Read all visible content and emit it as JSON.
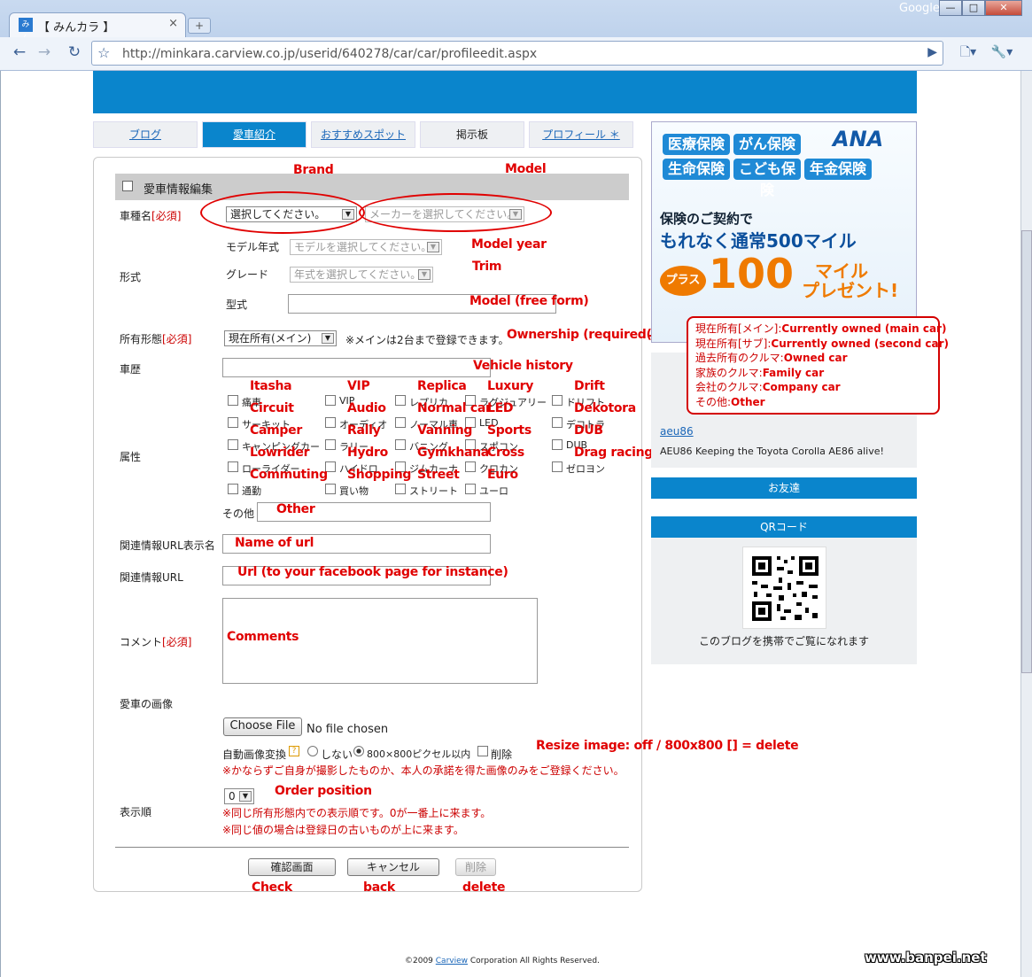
{
  "browser": {
    "tab_title": "【 みんカラ 】",
    "tab_close": "×",
    "new_tab": "+",
    "brand_label": "Google",
    "url": "http://minkara.carview.co.jp/userid/640278/car/car/profileedit.aspx",
    "window_buttons": [
      "—",
      "□",
      "✕"
    ]
  },
  "nav_tabs": [
    {
      "label": "ブログ"
    },
    {
      "label": "愛車紹介"
    },
    {
      "label": "おすすめスポット"
    },
    {
      "label": "掲示板"
    },
    {
      "label": "プロフィール ＊"
    }
  ],
  "form": {
    "header": "愛車情報編集",
    "car_name_label": "車種名",
    "required_tag": "[必須]",
    "brand_select": "選択してください。",
    "model_select": "メーカーを選択してください。",
    "model_year_label": "モデル年式",
    "model_year_select": "モデルを選択してください。",
    "grade_label": "グレード",
    "grade_select": "年式を選択してください。",
    "type_label": "形式",
    "katashiki_label": "型式",
    "ownership_label": "所有形態",
    "ownership_select": "現在所有(メイン)",
    "ownership_note": "※メインは2台まで登録できます。",
    "history_label": "車歴",
    "attributes_label": "属性",
    "attributes": [
      [
        "痛車",
        "VIP",
        "レプリカ",
        "ラグジュアリー",
        "ドリフト"
      ],
      [
        "サーキット",
        "オーディオ",
        "ノーマル車",
        "LED",
        "デコトラ"
      ],
      [
        "キャンピングカー",
        "ラリー",
        "バニング",
        "スポコン",
        "DUB"
      ],
      [
        "ローライダー",
        "ハイドロ",
        "ジムカーナ",
        "クロカン",
        "ゼロヨン"
      ],
      [
        "通勤",
        "買い物",
        "ストリート",
        "ユーロ"
      ]
    ],
    "other_label": "その他",
    "url_name_label": "関連情報URL表示名",
    "url_label": "関連情報URL",
    "comment_label": "コメント",
    "image_label": "愛車の画像",
    "choose_file": "Choose File",
    "no_file": "No file chosen",
    "auto_convert_label": "自動画像変換",
    "help_icon": "?",
    "radio_off": "しない",
    "radio_800": "800×800ピクセル以内",
    "delete_check": "削除",
    "image_notice": "※かならずご自身が撮影したものか、本人の承諾を得た画像のみをご登録ください。",
    "order_label": "表示順",
    "order_select": "0",
    "order_note1": "※同じ所有形態内での表示順です。0が一番上に来ます。",
    "order_note2": "※同じ値の場合は登録日の古いものが上に来ます。",
    "btn_confirm": "確認画面",
    "btn_cancel": "キャンセル",
    "btn_delete": "削除"
  },
  "annotations": {
    "brand": "Brand",
    "model": "Model",
    "model_year": "Model year",
    "trim": "Trim",
    "model_free": "Model (free form)",
    "ownership": "Ownership (required(",
    "vehicle_history": "Vehicle history",
    "attributes": [
      [
        "Itasha",
        "VIP",
        "Replica",
        "Luxury",
        "Drift"
      ],
      [
        "Circuit",
        "Audio",
        "Normal car",
        "LED",
        "Dekotora"
      ],
      [
        "Camper",
        "Rally",
        "Vanning",
        "Sports",
        "DUB"
      ],
      [
        "Lowrider",
        "Hydro",
        "Gymkhana",
        "Cross",
        "Drag racing"
      ],
      [
        "Commuting",
        "Shopping",
        "Street",
        "Euro"
      ]
    ],
    "other": "Other",
    "url_name": "Name of url",
    "url": "Url (to your facebook page for instance)",
    "comments": "Comments",
    "resize": "Resize image: off / 800x800    [] = delete",
    "order": "Order position",
    "check": "Check",
    "back": "back",
    "delete": "delete"
  },
  "legend": [
    {
      "jp": "現在所有[メイン]:",
      "en": "Currently owned (main car)"
    },
    {
      "jp": "現在所有[サブ]:",
      "en": "Currently owned (second car)"
    },
    {
      "jp": "過去所有のクルマ:",
      "en": "Owned car"
    },
    {
      "jp": "家族のクルマ:",
      "en": "Family car"
    },
    {
      "jp": "会社のクルマ:",
      "en": "Company car"
    },
    {
      "jp": "その他:",
      "en": "Other"
    }
  ],
  "ad": {
    "pills": [
      "医療保険",
      "がん保険",
      "生命保険",
      "こども保険",
      "年金保険"
    ],
    "logo": "ANA",
    "line1": "保険のご契約で",
    "line2": "もれなく通常500マイル",
    "plus": "プラス",
    "big": "100",
    "miles": "マイル",
    "present": "プレゼント!"
  },
  "sidebar": {
    "link": "aeu86",
    "desc": "AEU86 Keeping the Toyota Corolla AE86 alive!",
    "friends": "お友達",
    "qr_head": "QRコード",
    "qr_caption": "このブログを携帯でご覧になれます"
  },
  "footer": {
    "copy_pre": "©2009 ",
    "copy_link": "Carview",
    "copy_post": " Corporation All Rights Reserved.",
    "watermark": "www.banpei.net"
  }
}
